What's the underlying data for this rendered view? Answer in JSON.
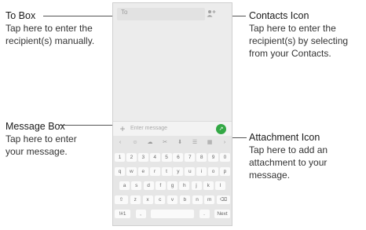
{
  "callouts": {
    "to_box": {
      "title": "To Box",
      "desc": [
        "Tap here to enter the",
        "recipient(s) manually."
      ]
    },
    "contacts_icon": {
      "title": "Contacts Icon",
      "desc": [
        "Tap here to enter the",
        "recipient(s) by selecting",
        "from your Contacts."
      ]
    },
    "message_box": {
      "title": "Message Box",
      "desc": [
        "Tap here to enter",
        "your message."
      ]
    },
    "attachment_icon": {
      "title": "Attachment Icon",
      "desc": [
        "Tap here to add an",
        "attachment to your",
        "message."
      ]
    }
  },
  "phone": {
    "to_label": "To",
    "message_placeholder": "Enter message",
    "send_label": "↗",
    "contacts_icon": "person-plus-icon",
    "attach_icon": "plus-icon"
  },
  "keyboard": {
    "toolbar": [
      "‹",
      "☺",
      "☁",
      "✂",
      "⬇",
      "☰",
      "▦",
      "›"
    ],
    "row1": [
      "1",
      "2",
      "3",
      "4",
      "5",
      "6",
      "7",
      "8",
      "9",
      "0"
    ],
    "row2": [
      "q",
      "w",
      "e",
      "r",
      "t",
      "y",
      "u",
      "i",
      "o",
      "p"
    ],
    "row3": [
      "a",
      "s",
      "d",
      "f",
      "g",
      "h",
      "j",
      "k",
      "l"
    ],
    "row4": [
      "⇧",
      "z",
      "x",
      "c",
      "v",
      "b",
      "n",
      "m",
      "⌫"
    ],
    "row5": [
      "!#1",
      ",",
      "",
      ".",
      "Next"
    ]
  }
}
